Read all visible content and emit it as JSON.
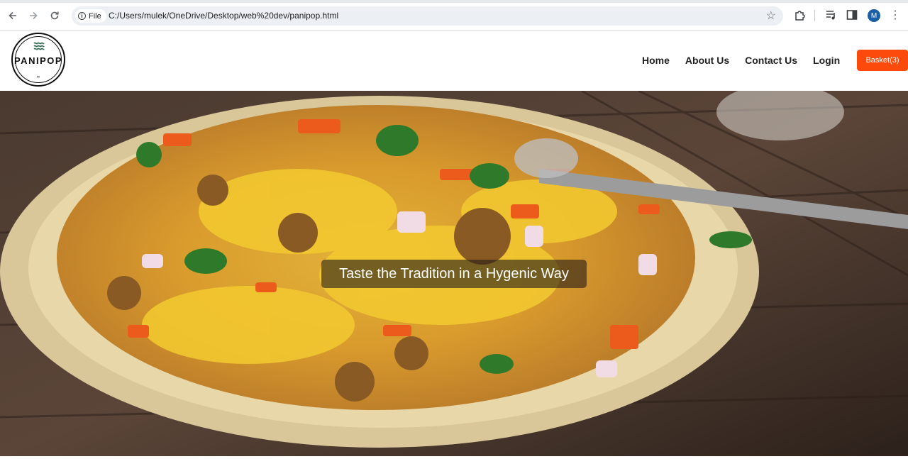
{
  "browser": {
    "file_chip_label": "File",
    "url": "C:/Users/mulek/OneDrive/Desktop/web%20dev/panipop.html",
    "profile_initial": "M"
  },
  "site": {
    "logo_text": "PANIPOP",
    "nav": [
      {
        "label": "Home"
      },
      {
        "label": "About Us"
      },
      {
        "label": "Contact Us"
      },
      {
        "label": "Login"
      }
    ],
    "basket_label": "Basket(3)"
  },
  "hero": {
    "tagline": "Taste the Tradition in a Hygenic Way"
  },
  "colors": {
    "accent": "#fb4a0b",
    "logo_wave": "#2e6b4f"
  }
}
